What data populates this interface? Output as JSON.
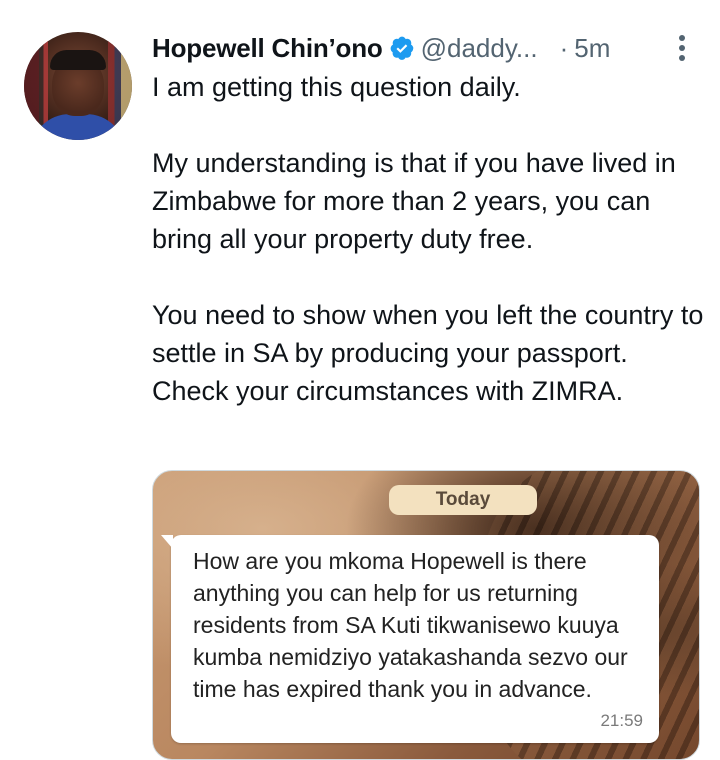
{
  "author": {
    "display_name": "Hopewell Chin’ono",
    "handle": "@daddy...",
    "separator": "·",
    "time_ago": "5m",
    "verified": true,
    "avatar_icon": "profile-photo"
  },
  "tweet": {
    "paragraphs": [
      "I am getting this question daily.",
      "My understanding is that if you have lived in Zimbabwe for more than 2 years, you can bring all your property duty free.",
      "You need to show when you left the country to settle in SA by producing your passport.",
      "Check your circumstances with ZIMRA."
    ]
  },
  "media": {
    "date_chip": "Today",
    "message": "How are you mkoma Hopewell is there anything you can help for us returning residents from SA Kuti tikwanisewo kuuya kumba nemidziyo yatakashanda sezvo our time has expired thank you in advance.",
    "timestamp": "21:59"
  },
  "icons": {
    "verified": "verified-badge-icon",
    "more": "more-vertical-icon"
  },
  "colors": {
    "accent": "#1d9bf0",
    "text": "#0f1419",
    "secondary": "#536471",
    "chip": "#f3e1bf"
  }
}
